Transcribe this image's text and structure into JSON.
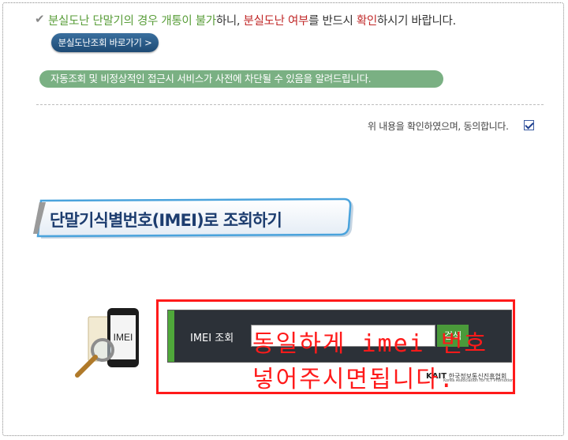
{
  "notice": {
    "check_icon": "check-icon",
    "part1": "분실도난 단말기의 경우 개통이 불가",
    "part2": "하니, ",
    "part3": "분실도난 여부",
    "part4": "를 반드시 ",
    "part5": "확인",
    "part6": "하시기 바랍니다."
  },
  "lost_lookup_button": "분실도난조회 바로가기 >",
  "block_notice": "자동조회 및 비정상적인 접근시 서비스가 사전에 차단될 수 있음을 알려드립니다.",
  "agree": {
    "label": "위 내용을 확인하였으며, 동의합니다.",
    "checked": true
  },
  "section_title": "단말기식별번호(IMEI)로 조회하기",
  "phone_screen_text": "IMEI",
  "imei_panel": {
    "label": "IMEI 조회",
    "input_value": "",
    "search_button": "검색"
  },
  "logo": {
    "brand": "KAIT",
    "org": "한국정보통신진흥협회",
    "tagline": "Korea Association for ICT Promotion"
  },
  "annotation": {
    "line1": "동일하게 imei 번호",
    "line2": "넣어주시면됩니다."
  },
  "colors": {
    "accent_green": "#4fa83a",
    "annotation_red": "#ff1a1a",
    "title_blue": "#1d3d6f"
  }
}
